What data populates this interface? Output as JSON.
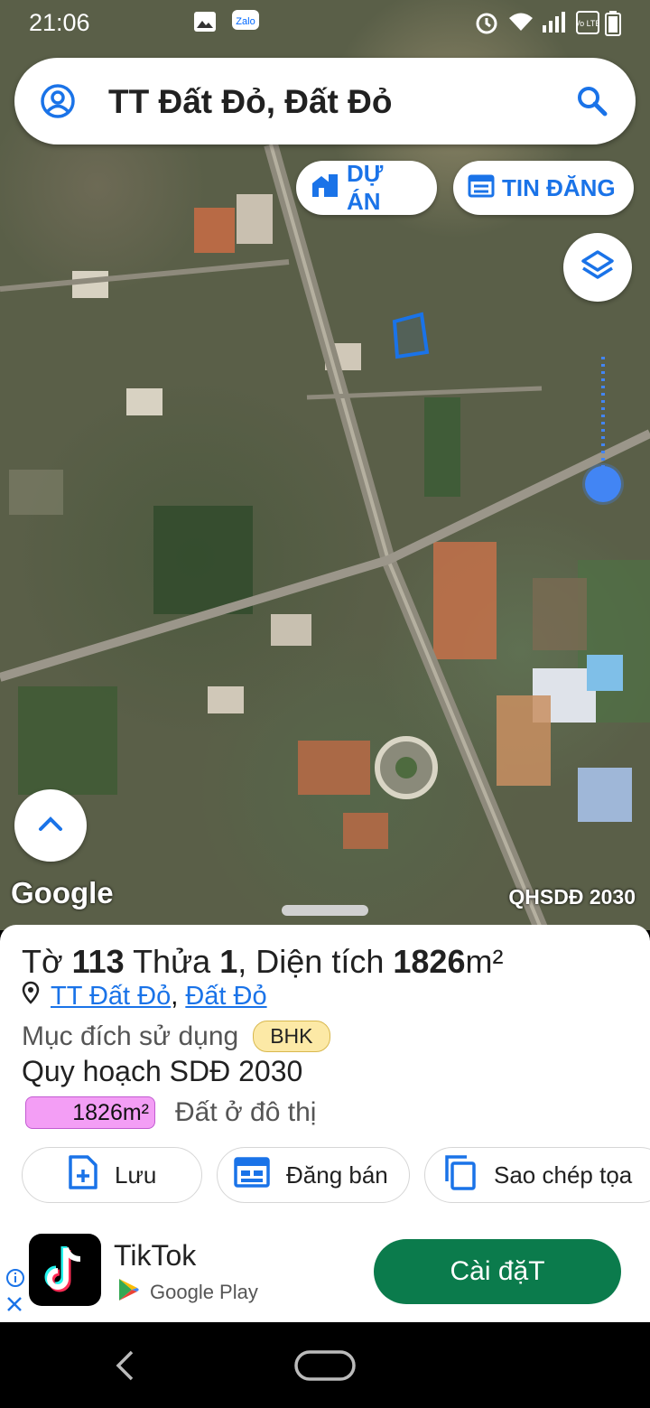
{
  "status_bar": {
    "time": "21:06",
    "icons": [
      "gallery-icon",
      "zalo-icon",
      "alarm-icon",
      "wifi-icon",
      "signal-icon",
      "volte-icon",
      "battery-icon"
    ],
    "zalo_label": "Zalo",
    "volte_label": "Vo LTE"
  },
  "search": {
    "title": "TT Đất Đỏ, Đất Đỏ"
  },
  "map_buttons": {
    "du_an": "DỰ ÁN",
    "tin_dang": "TIN ĐĂNG"
  },
  "map": {
    "google_logo": "Google",
    "overlay_label": "QHSDĐ 2030"
  },
  "parcel": {
    "prefix_to": "Tờ",
    "to_number": "113",
    "prefix_thua": "Thửa",
    "thua_number": "1",
    "prefix_area": "Diện tích",
    "area": "1826",
    "unit": "m²",
    "address_part1": "TT Đất Đỏ",
    "address_sep": ",",
    "address_part2": "Đất Đỏ",
    "purpose_label": "Mục đích sử dụng",
    "purpose_code": "BHK",
    "plan_label": "Quy hoạch SDĐ 2030",
    "plan_area": "1826m²",
    "plan_landuse": "Đất ở đô thị",
    "plan_color": "#f39ef5"
  },
  "actions": {
    "save": "Lưu",
    "sell": "Đăng bán",
    "copy": "Sao chép tọa"
  },
  "ad": {
    "app_name": "TikTok",
    "store": "Google Play",
    "install": "Cài đặT"
  },
  "colors": {
    "accent": "#1a73e8",
    "install_bg": "#0b7b4c",
    "location_dot": "#4285f4"
  }
}
